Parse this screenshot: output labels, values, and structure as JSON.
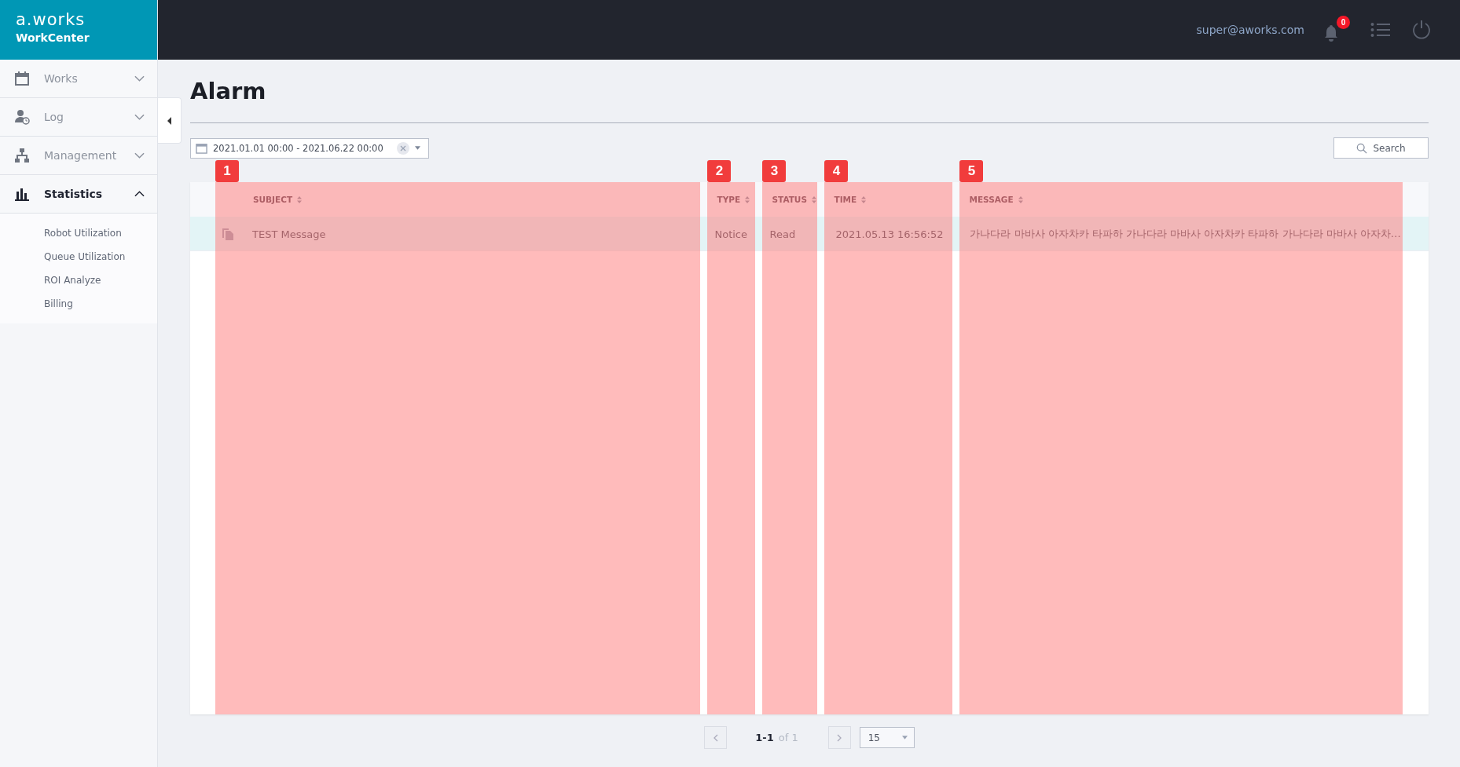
{
  "header": {
    "logo": "a.works",
    "product": "WorkCenter",
    "user": "super@aworks.com",
    "notification_count": "0"
  },
  "sidebar": {
    "items": [
      {
        "label": "Works",
        "expanded": false
      },
      {
        "label": "Log",
        "expanded": false
      },
      {
        "label": "Management",
        "expanded": false
      },
      {
        "label": "Statistics",
        "expanded": true,
        "children": [
          {
            "label": "Robot Utilization"
          },
          {
            "label": "Queue Utilization"
          },
          {
            "label": "ROI Analyze"
          },
          {
            "label": "Billing"
          }
        ]
      }
    ]
  },
  "page": {
    "title": "Alarm"
  },
  "filter": {
    "date_range": "2021.01.01 00:00 - 2021.06.22 00:00",
    "search_button": "Search"
  },
  "table": {
    "columns": [
      {
        "label": "SUBJECT",
        "annotation": "1"
      },
      {
        "label": "TYPE",
        "annotation": "2"
      },
      {
        "label": "STATUS",
        "annotation": "3"
      },
      {
        "label": "TIME",
        "annotation": "4"
      },
      {
        "label": "MESSAGE",
        "annotation": "5"
      }
    ],
    "rows": [
      {
        "subject": "TEST Message",
        "type": "Notice",
        "status": "Read",
        "time": "2021.05.13 16:56:52",
        "message": "가나다라 마바사 아자차카 타파하 가나다라 마바사 아자차카 타파하 가나다라 마바사 아자차…",
        "selected": true
      }
    ]
  },
  "pagination": {
    "range": "1-1",
    "total": "of 1",
    "page_size": "15"
  }
}
